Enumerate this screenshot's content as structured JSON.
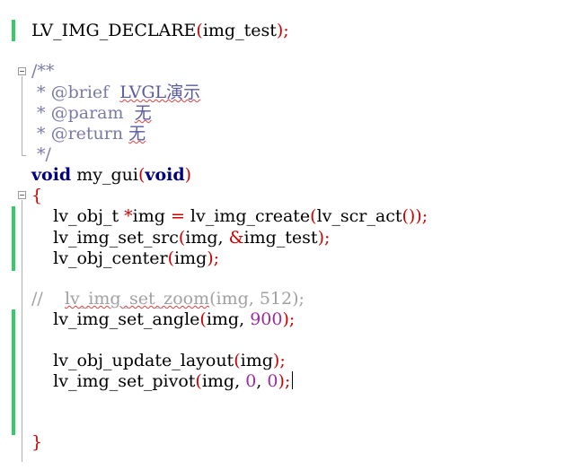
{
  "lines": {
    "l1": {
      "text": "LV_IMG_DECLARE",
      "p_open": "(",
      "arg": "img_test",
      "p_close": ")",
      "semi": ";"
    },
    "l3": {
      "text": "/**"
    },
    "l4": {
      "star": " * ",
      "tag": "@brief",
      "space": "  ",
      "val": "LVGL演示"
    },
    "l5": {
      "star": " * ",
      "tag": "@param",
      "space": "  ",
      "val": "无"
    },
    "l6": {
      "star": " * ",
      "tag": "@return",
      "space": " ",
      "val": "无"
    },
    "l7": {
      "text": " */"
    },
    "l8": {
      "kw1": "void",
      "name": " my_gui",
      "p_open": "(",
      "kw2": "void",
      "p_close": ")"
    },
    "l9": {
      "text": "{"
    },
    "l10": {
      "indent": "    ",
      "a": "lv_obj_t ",
      "star": "*",
      "b": "img ",
      "eq": "=",
      "c": " lv_img_create",
      "p1": "(",
      "d": "lv_scr_act",
      "p2": "()",
      "p3": ")",
      "semi": ";"
    },
    "l11": {
      "indent": "    ",
      "a": "lv_img_set_src",
      "p1": "(",
      "b": "img, ",
      "amp": "&",
      "c": "img_test",
      "p2": ")",
      "semi": ";"
    },
    "l12": {
      "indent": "    ",
      "a": "lv_obj_center",
      "p1": "(",
      "b": "img",
      "p2": ")",
      "semi": ";"
    },
    "l14": {
      "slashes": "//",
      "pad": "    ",
      "fn": "lv_img_set_zoom",
      "rest": "(img, 512);"
    },
    "l15": {
      "indent": "    ",
      "a": "lv_img_set_angle",
      "p1": "(",
      "b": "img, ",
      "num": "900",
      "p2": ")",
      "semi": ";"
    },
    "l17": {
      "indent": "    ",
      "a": "lv_obj_update_layout",
      "p1": "(",
      "b": "img",
      "p2": ")",
      "semi": ";"
    },
    "l18": {
      "indent": "    ",
      "a": "lv_img_set_pivot",
      "p1": "(",
      "b": "img, ",
      "n1": "0",
      "comma": ", ",
      "n2": "0",
      "p2": ")",
      "semi": ";"
    },
    "l22": {
      "text": "}"
    }
  }
}
